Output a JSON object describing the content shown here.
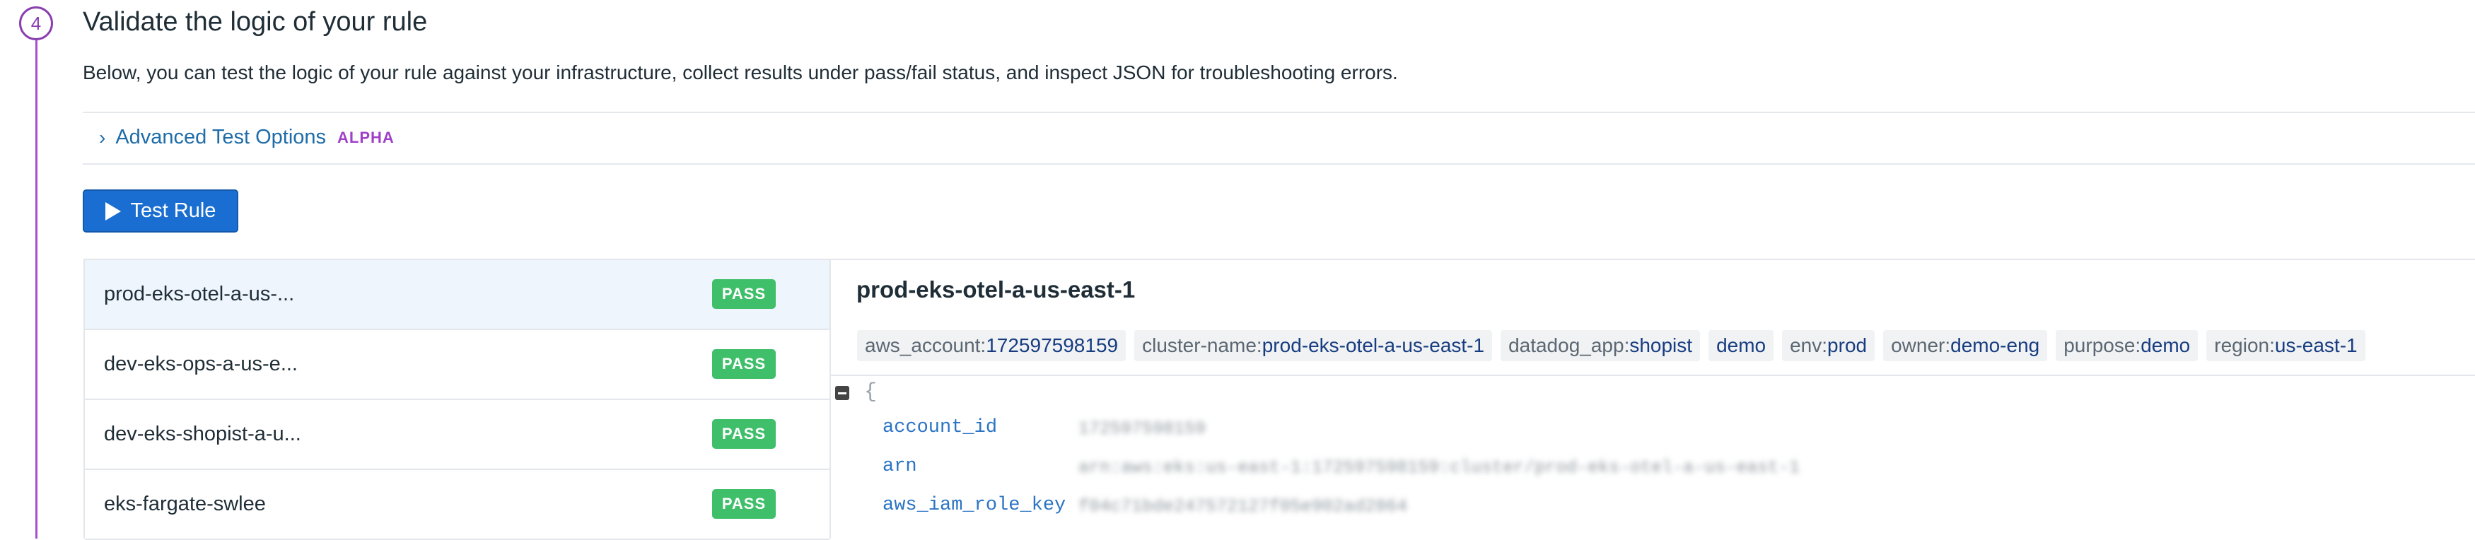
{
  "step": {
    "number": "4",
    "title": "Validate the logic of your rule"
  },
  "description": "Below, you can test the logic of your rule against your infrastructure, collect results under pass/fail status, and inspect JSON for troubleshooting errors.",
  "advanced": {
    "label": "Advanced Test Options",
    "badge": "ALPHA"
  },
  "test_button": {
    "label": "Test Rule"
  },
  "results": [
    {
      "name": "prod-eks-otel-a-us-...",
      "status": "PASS"
    },
    {
      "name": "dev-eks-ops-a-us-e...",
      "status": "PASS"
    },
    {
      "name": "dev-eks-shopist-a-u...",
      "status": "PASS"
    },
    {
      "name": "eks-fargate-swlee",
      "status": "PASS"
    }
  ],
  "detail": {
    "title": "prod-eks-otel-a-us-east-1",
    "tags": [
      {
        "key": "aws_account:",
        "value": "172597598159"
      },
      {
        "key": "cluster-name:",
        "value": "prod-eks-otel-a-us-east-1"
      },
      {
        "key": "datadog_app:",
        "value": "shopist"
      },
      {
        "key": "",
        "value": "demo"
      },
      {
        "key": "env:",
        "value": "prod"
      },
      {
        "key": "owner:",
        "value": "demo-eng"
      },
      {
        "key": "purpose:",
        "value": "demo"
      },
      {
        "key": "region:",
        "value": "us-east-1"
      }
    ],
    "json_open": "{",
    "json": [
      {
        "key": "account_id",
        "value": "172597598159"
      },
      {
        "key": "arn",
        "value": "arn:aws:eks:us-east-1:172597598159:cluster/prod-eks-otel-a-us-east-1"
      },
      {
        "key": "aws_iam_role_key",
        "value": "f04c71bde247572127f05e902ad2864"
      }
    ]
  },
  "colors": {
    "accent": "#8a3fb1",
    "link": "#1e6ca8",
    "button": "#1b6ed1",
    "pass": "#3fbf6a"
  }
}
